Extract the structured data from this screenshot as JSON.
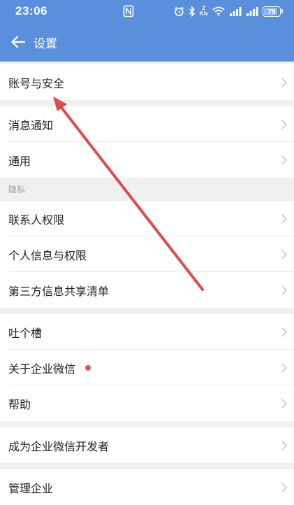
{
  "status_bar": {
    "time": "23:06",
    "network_speed_value": "2",
    "network_speed_unit": "K/s",
    "battery": "79"
  },
  "header": {
    "title": "设置"
  },
  "settings": {
    "account_security": "账号与安全",
    "notifications": "消息通知",
    "general": "通用",
    "privacy_header": "隐私",
    "contacts_permission": "联系人权限",
    "personal_info_permission": "个人信息与权限",
    "third_party_sharing": "第三方信息共享清单",
    "feedback": "吐个槽",
    "about": "关于企业微信",
    "help": "帮助",
    "become_developer": "成为企业微信开发者",
    "manage_enterprise": "管理企业"
  },
  "colors": {
    "header_bg": "#5a8fdc",
    "page_bg": "#f0f0f0",
    "arrow": "#e04b4b",
    "badge": "#e8554e"
  }
}
